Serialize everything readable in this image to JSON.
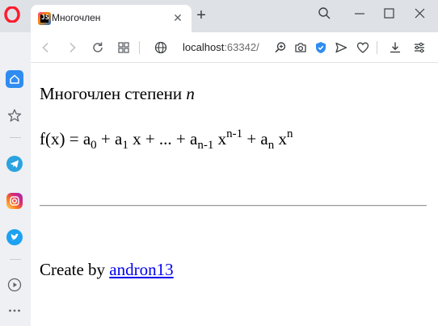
{
  "browser": {
    "tab": {
      "title": "Многочлен",
      "favicon": "jetbrains-icon"
    },
    "address": {
      "host": "localhost",
      "port": ":63342/"
    },
    "window_controls": [
      "minimize-icon",
      "maximize-icon",
      "close-icon"
    ],
    "accent_color": "#2f8cf0"
  },
  "sidebar": {
    "items": [
      "home-icon",
      "bookmarks-icon",
      "telegram-icon",
      "instagram-icon",
      "twitter-icon",
      "player-icon",
      "more-icon"
    ]
  },
  "page": {
    "heading_text": "Многочлен степени ",
    "heading_var": "n",
    "formula": {
      "p1": "f(x) = a",
      "s0": "0",
      "p2": " + a",
      "s1": "1",
      "p3": " x + ... + a",
      "sn1": "n-1",
      "p4": " x",
      "supn1": "n-1",
      "p5": " + a",
      "sn": "n",
      "p6": " x",
      "supn": "n"
    },
    "footer_text": "Create by ",
    "footer_link": "andron13"
  }
}
